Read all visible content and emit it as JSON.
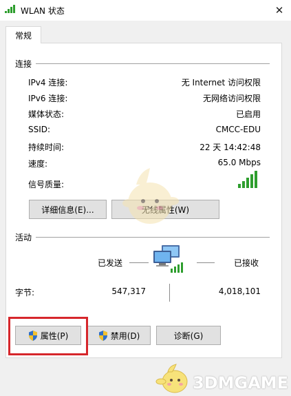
{
  "window": {
    "title": "WLAN 状态",
    "close_symbol": "✕"
  },
  "tabs": [
    {
      "label": "常规"
    }
  ],
  "connection": {
    "section_title": "连接",
    "rows": [
      {
        "label": "IPv4 连接:",
        "value": "无 Internet 访问权限"
      },
      {
        "label": "IPv6 连接:",
        "value": "无网络访问权限"
      },
      {
        "label": "媒体状态:",
        "value": "已启用"
      },
      {
        "label": "SSID:",
        "value": "CMCC-EDU"
      },
      {
        "label": "持续时间:",
        "value": "22 天 14:42:48"
      },
      {
        "label": "速度:",
        "value": "65.0 Mbps"
      }
    ],
    "signal_label": "信号质量:",
    "signal_icon": "signal-strength-icon",
    "signal_bars_lit": 5,
    "signal_bars_total": 5,
    "details_button": "详细信息(E)...",
    "wireless_props_button": "无线属性(W)"
  },
  "activity": {
    "section_title": "活动",
    "sent_label": "已发送",
    "received_label": "已接收",
    "bytes_label": "字节:",
    "bytes_sent": "547,317",
    "bytes_received": "4,018,101",
    "network_icon": "network-computers-icon"
  },
  "footer_buttons": {
    "properties": "属性(P)",
    "disable": "禁用(D)",
    "diagnose": "诊断(G)"
  },
  "watermark": {
    "text": "3DMGAME"
  },
  "colors": {
    "highlight_border": "#d6262b",
    "signal_green": "#2e9e2e",
    "button_face": "#e1e1e1",
    "panel_border": "#d9d9d9"
  }
}
